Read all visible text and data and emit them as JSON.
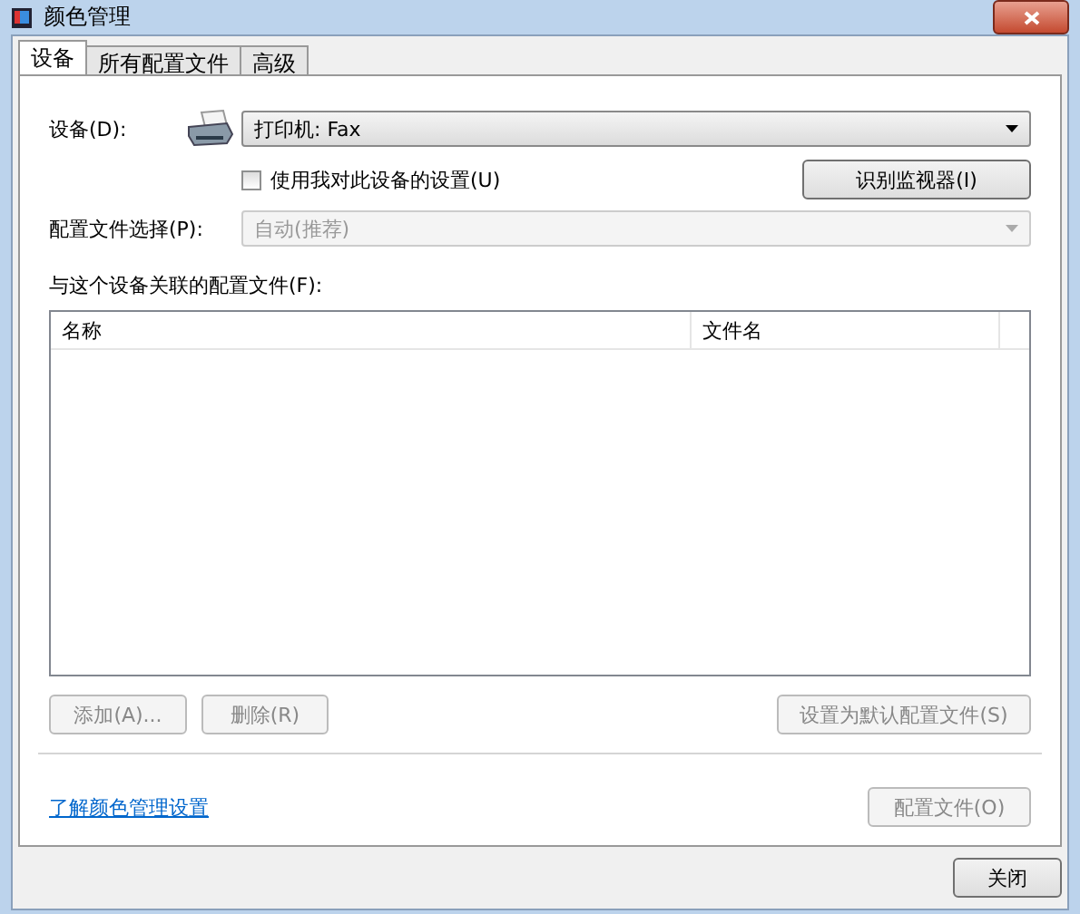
{
  "window": {
    "title": "颜色管理"
  },
  "tabs": [
    {
      "label": "设备",
      "selected": true
    },
    {
      "label": "所有配置文件",
      "selected": false
    },
    {
      "label": "高级",
      "selected": false
    }
  ],
  "device": {
    "label": "设备(D):",
    "value": "打印机: Fax"
  },
  "use_my_settings": {
    "label": "使用我对此设备的设置(U)",
    "checked": false
  },
  "identify_button": {
    "label": "识别监视器(I)",
    "disabled": false
  },
  "profile_selection": {
    "label": "配置文件选择(P):",
    "value": "自动(推荐)",
    "disabled": true
  },
  "profiles_label": "与这个设备关联的配置文件(F):",
  "table": {
    "columns": [
      "名称",
      "文件名"
    ]
  },
  "buttons": [
    {
      "label": "添加(A)...",
      "disabled": true
    },
    {
      "label": "删除(R)",
      "disabled": true
    },
    {
      "label": "设置为默认配置文件(S)",
      "disabled": true
    }
  ],
  "link": "了解颜色管理设置",
  "profile_button": {
    "label": "配置文件(O)",
    "disabled": true
  },
  "close_button": {
    "label": "关闭",
    "disabled": false
  }
}
